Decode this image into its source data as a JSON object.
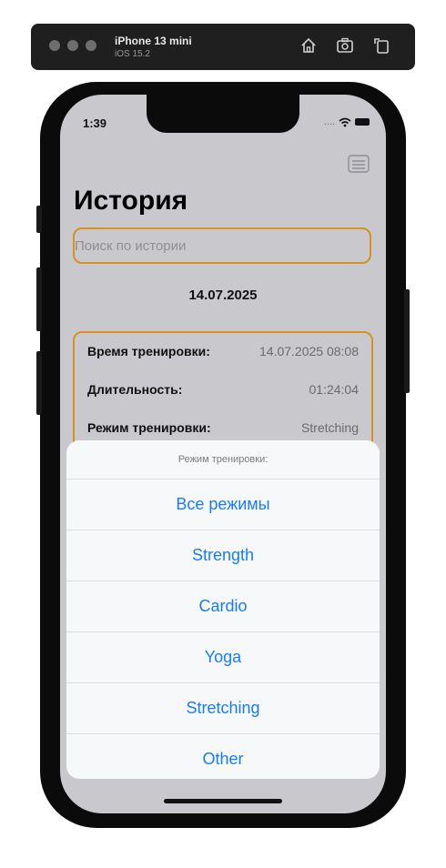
{
  "simulator": {
    "device": "iPhone 13 mini",
    "os": "iOS 15.2",
    "icons": [
      "home-icon",
      "screenshot-icon",
      "rotate-icon"
    ]
  },
  "status": {
    "time": "1:39",
    "signal": "....",
    "icons": [
      "wifi-icon",
      "battery-icon"
    ]
  },
  "header": {
    "title": "История",
    "filter_icon": "filter-icon"
  },
  "search": {
    "placeholder": "Поиск по истории",
    "value": ""
  },
  "history": {
    "date": "14.07.2025",
    "entry": {
      "rows": [
        {
          "label": "Время тренировки:",
          "value": "14.07.2025 08:08"
        },
        {
          "label": "Длительность:",
          "value": "01:24:04"
        },
        {
          "label": "Режим тренировки:",
          "value": "Stretching"
        }
      ]
    }
  },
  "action_sheet": {
    "title": "Режим тренировки:",
    "options": [
      "Все режимы",
      "Strength",
      "Cardio",
      "Yoga",
      "Stretching",
      "Other"
    ]
  },
  "colors": {
    "accent_border": "#d9911f",
    "action_blue": "#1a7cf5"
  }
}
